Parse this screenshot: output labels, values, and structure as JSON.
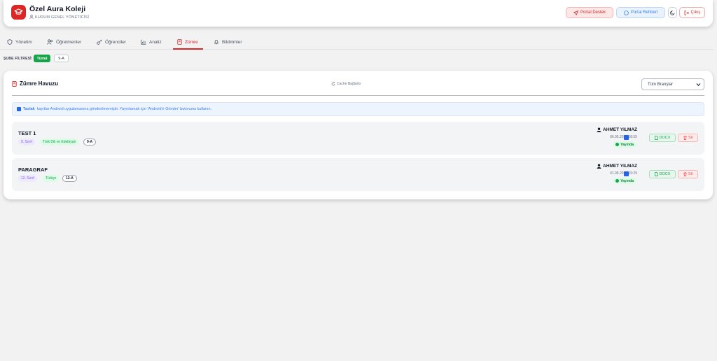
{
  "header": {
    "title": "Özel Aura Koleji",
    "subtitle": "KURUM GENEL YÖNETİCİSİ",
    "buttons": {
      "portal_destek": "Portal Destek",
      "portal_rehberi": "Portal Rehberi",
      "cikis": "Çıkış"
    },
    "accent_color": "#dc2626"
  },
  "tabs": [
    {
      "label": "Yönetim",
      "icon": "shield-icon"
    },
    {
      "label": "Öğretmenler",
      "icon": "users-icon"
    },
    {
      "label": "Öğrenciler",
      "icon": "key-icon"
    },
    {
      "label": "Analiz",
      "icon": "bar-chart-icon"
    },
    {
      "label": "Zümre",
      "icon": "book-icon",
      "active": true
    },
    {
      "label": "Bildirimler",
      "icon": "bell-icon"
    }
  ],
  "filter": {
    "label": "ŞUBE FİLTRESİ:",
    "chips": [
      "Tümü",
      "9-A"
    ],
    "selected": "Tümü"
  },
  "card": {
    "title": "Zümre Havuzu",
    "cache_button": "Cache Bağlantı",
    "select_value": "Tüm Branşlar",
    "info_bold": "Taslak",
    "info_text": "kayıtlar Android uygulamasına gönderilmemiştir. Yayınlamak için 'Android'e Gönder' butonunu kullanın."
  },
  "rows": [
    {
      "title": "TEST 1",
      "sinif": "9. Sınıf",
      "ders": "Türk Dili ve Edebiyatı",
      "sube": "9-A",
      "author": "AHMET YILMAZ",
      "date": "06.05.2026 18:55",
      "status": "Yayında",
      "docx_label": "DOCX",
      "sil_label": "Sil"
    },
    {
      "title": "PARAGRAF",
      "sinif": "12. Sınıf",
      "ders": "Türkçe",
      "sube": "12-A",
      "author": "AHMET YILMAZ",
      "date": "01.05.2026 19:29",
      "status": "Yayında",
      "docx_label": "DOCX",
      "sil_label": "Sil"
    }
  ]
}
